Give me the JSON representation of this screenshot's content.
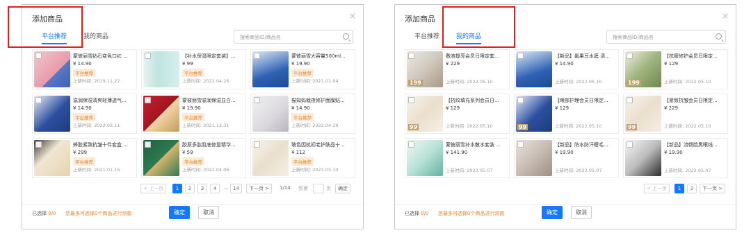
{
  "left": {
    "title": "添加商品",
    "close": "×",
    "tabs": [
      "平台推荐",
      "我的商品"
    ],
    "search_placeholder": "搜索商品ID/商品名",
    "items": [
      {
        "name": "蒙彼丽雪钻石变色口红 ...",
        "price": "¥ 14.90",
        "tag": "平台推荐",
        "date": "上新时间:  2019.11.22",
        "thumb": "t-pink"
      },
      {
        "name": "【补水保湿限定套装】...",
        "price": "¥ 99",
        "tag": "平台推荐",
        "date": "上新时间:  2022.04.26",
        "thumb": "t-teal"
      },
      {
        "name": "蒙彼丽雪大容量500ml...",
        "price": "¥ 19.90",
        "tag": "平台推荐",
        "date": "上新时间:  2021.01.04",
        "thumb": "t-blue"
      },
      {
        "name": "滋润保湿清爽轻薄透气...",
        "price": "¥ 14.90",
        "tag": "平台推荐",
        "date": "上新时间:  2022.02.11",
        "thumb": "t-navy"
      },
      {
        "name": "蒙彼丽雪滋润保湿显白...",
        "price": "¥ 19.90",
        "tag": "平台推荐",
        "date": "上新时间:  2021.12.31",
        "thumb": "t-red"
      },
      {
        "name": "猫知蚂栽夜修护面膜贴...",
        "price": "¥ 14.90",
        "tag": "平台推荐",
        "date": "上新时间:  2022.04.19",
        "thumb": "t-gray"
      },
      {
        "name": "蜂胶紧致抗皱十件套盒 ...",
        "price": "¥ 299",
        "tag": "平台推荐",
        "date": "上新时间:  2021.01.15",
        "thumb": "t-beige"
      },
      {
        "name": "胶原多肽肌底修复精华...",
        "price": "¥ 59",
        "tag": "平台推荐",
        "date": "上新时间:  2022.04.06",
        "thumb": "t-green"
      },
      {
        "name": "玻色因抗初老护肤品十...",
        "price": "¥ 112",
        "tag": "平台推荐",
        "date": "上新时间:  2021.05.10",
        "thumb": "t-white"
      }
    ],
    "pager": {
      "prev": "< 上一页",
      "pages": [
        "1",
        "2",
        "3",
        "4",
        "...",
        "14"
      ],
      "next": "下一页 >",
      "total": "1/14",
      "goto": "到第",
      "page_unit": "页",
      "confirm": "确定"
    },
    "selected_label": "已选择",
    "selected_count": "0/0",
    "hint": "您最多可选择0个商品进行测款",
    "ok": "确定",
    "cancel": "取消"
  },
  "right": {
    "title": "添加商品",
    "close": "×",
    "tabs": [
      "平台推荐",
      "我的商品"
    ],
    "search_placeholder": "搜索商品ID/商品名",
    "items": [
      {
        "name": "敷液提亮会员日限定套...",
        "price": "¥ 229",
        "date": "上新时间:  2022.05.10",
        "thumb": "t-silver",
        "badge": "199"
      },
      {
        "name": "【新品】氟果豆水膜 清...",
        "price": "¥ 14.90",
        "date": "上新时间:  2022.05.10",
        "thumb": "t-blue",
        "badge": ""
      },
      {
        "name": "【抗瘦修护会员日限定...",
        "price": "¥ 129",
        "date": "上新时间:  2022.05.10",
        "thumb": "t-olive",
        "badge": "199"
      },
      {
        "name": "【抗纹填充系列会员日...",
        "price": "¥ 129",
        "date": "上新时间:  2022.05.10",
        "thumb": "t-white",
        "badge": "99"
      },
      {
        "name": "【眼部护理会员日限定...",
        "price": "¥ 129",
        "date": "上新时间:  2022.05.10",
        "thumb": "t-navy",
        "badge": "99"
      },
      {
        "name": "【紧致抗皱会员日限定...",
        "price": "¥ 229",
        "date": "上新时间:  2022.05.10",
        "thumb": "t-white",
        "badge": "99"
      },
      {
        "name": "蒙彼丽雪补水散水套装 ...",
        "price": "¥ 141.90",
        "date": "上新时间:  2022.05.07",
        "thumb": "t-mint",
        "badge": ""
      },
      {
        "name": "【新品】防水防汗睫毛...",
        "price": "¥ 19.90",
        "date": "上新时间:  2022.05.07",
        "thumb": "t-eye",
        "badge": ""
      },
      {
        "name": "【新品】流畅脸黑眼线...",
        "price": "¥ 19.90",
        "date": "上新时间:  2022.05.07",
        "thumb": "t-dark",
        "badge": ""
      }
    ],
    "pager": {
      "prev": "< 上一页",
      "pages": [
        "1",
        "2"
      ],
      "next": "下一页 >"
    },
    "selected_label": "已选择",
    "selected_count": "0/0",
    "hint": "您最多可选择0个商品进行测款",
    "ok": "确定",
    "cancel": "取消"
  }
}
